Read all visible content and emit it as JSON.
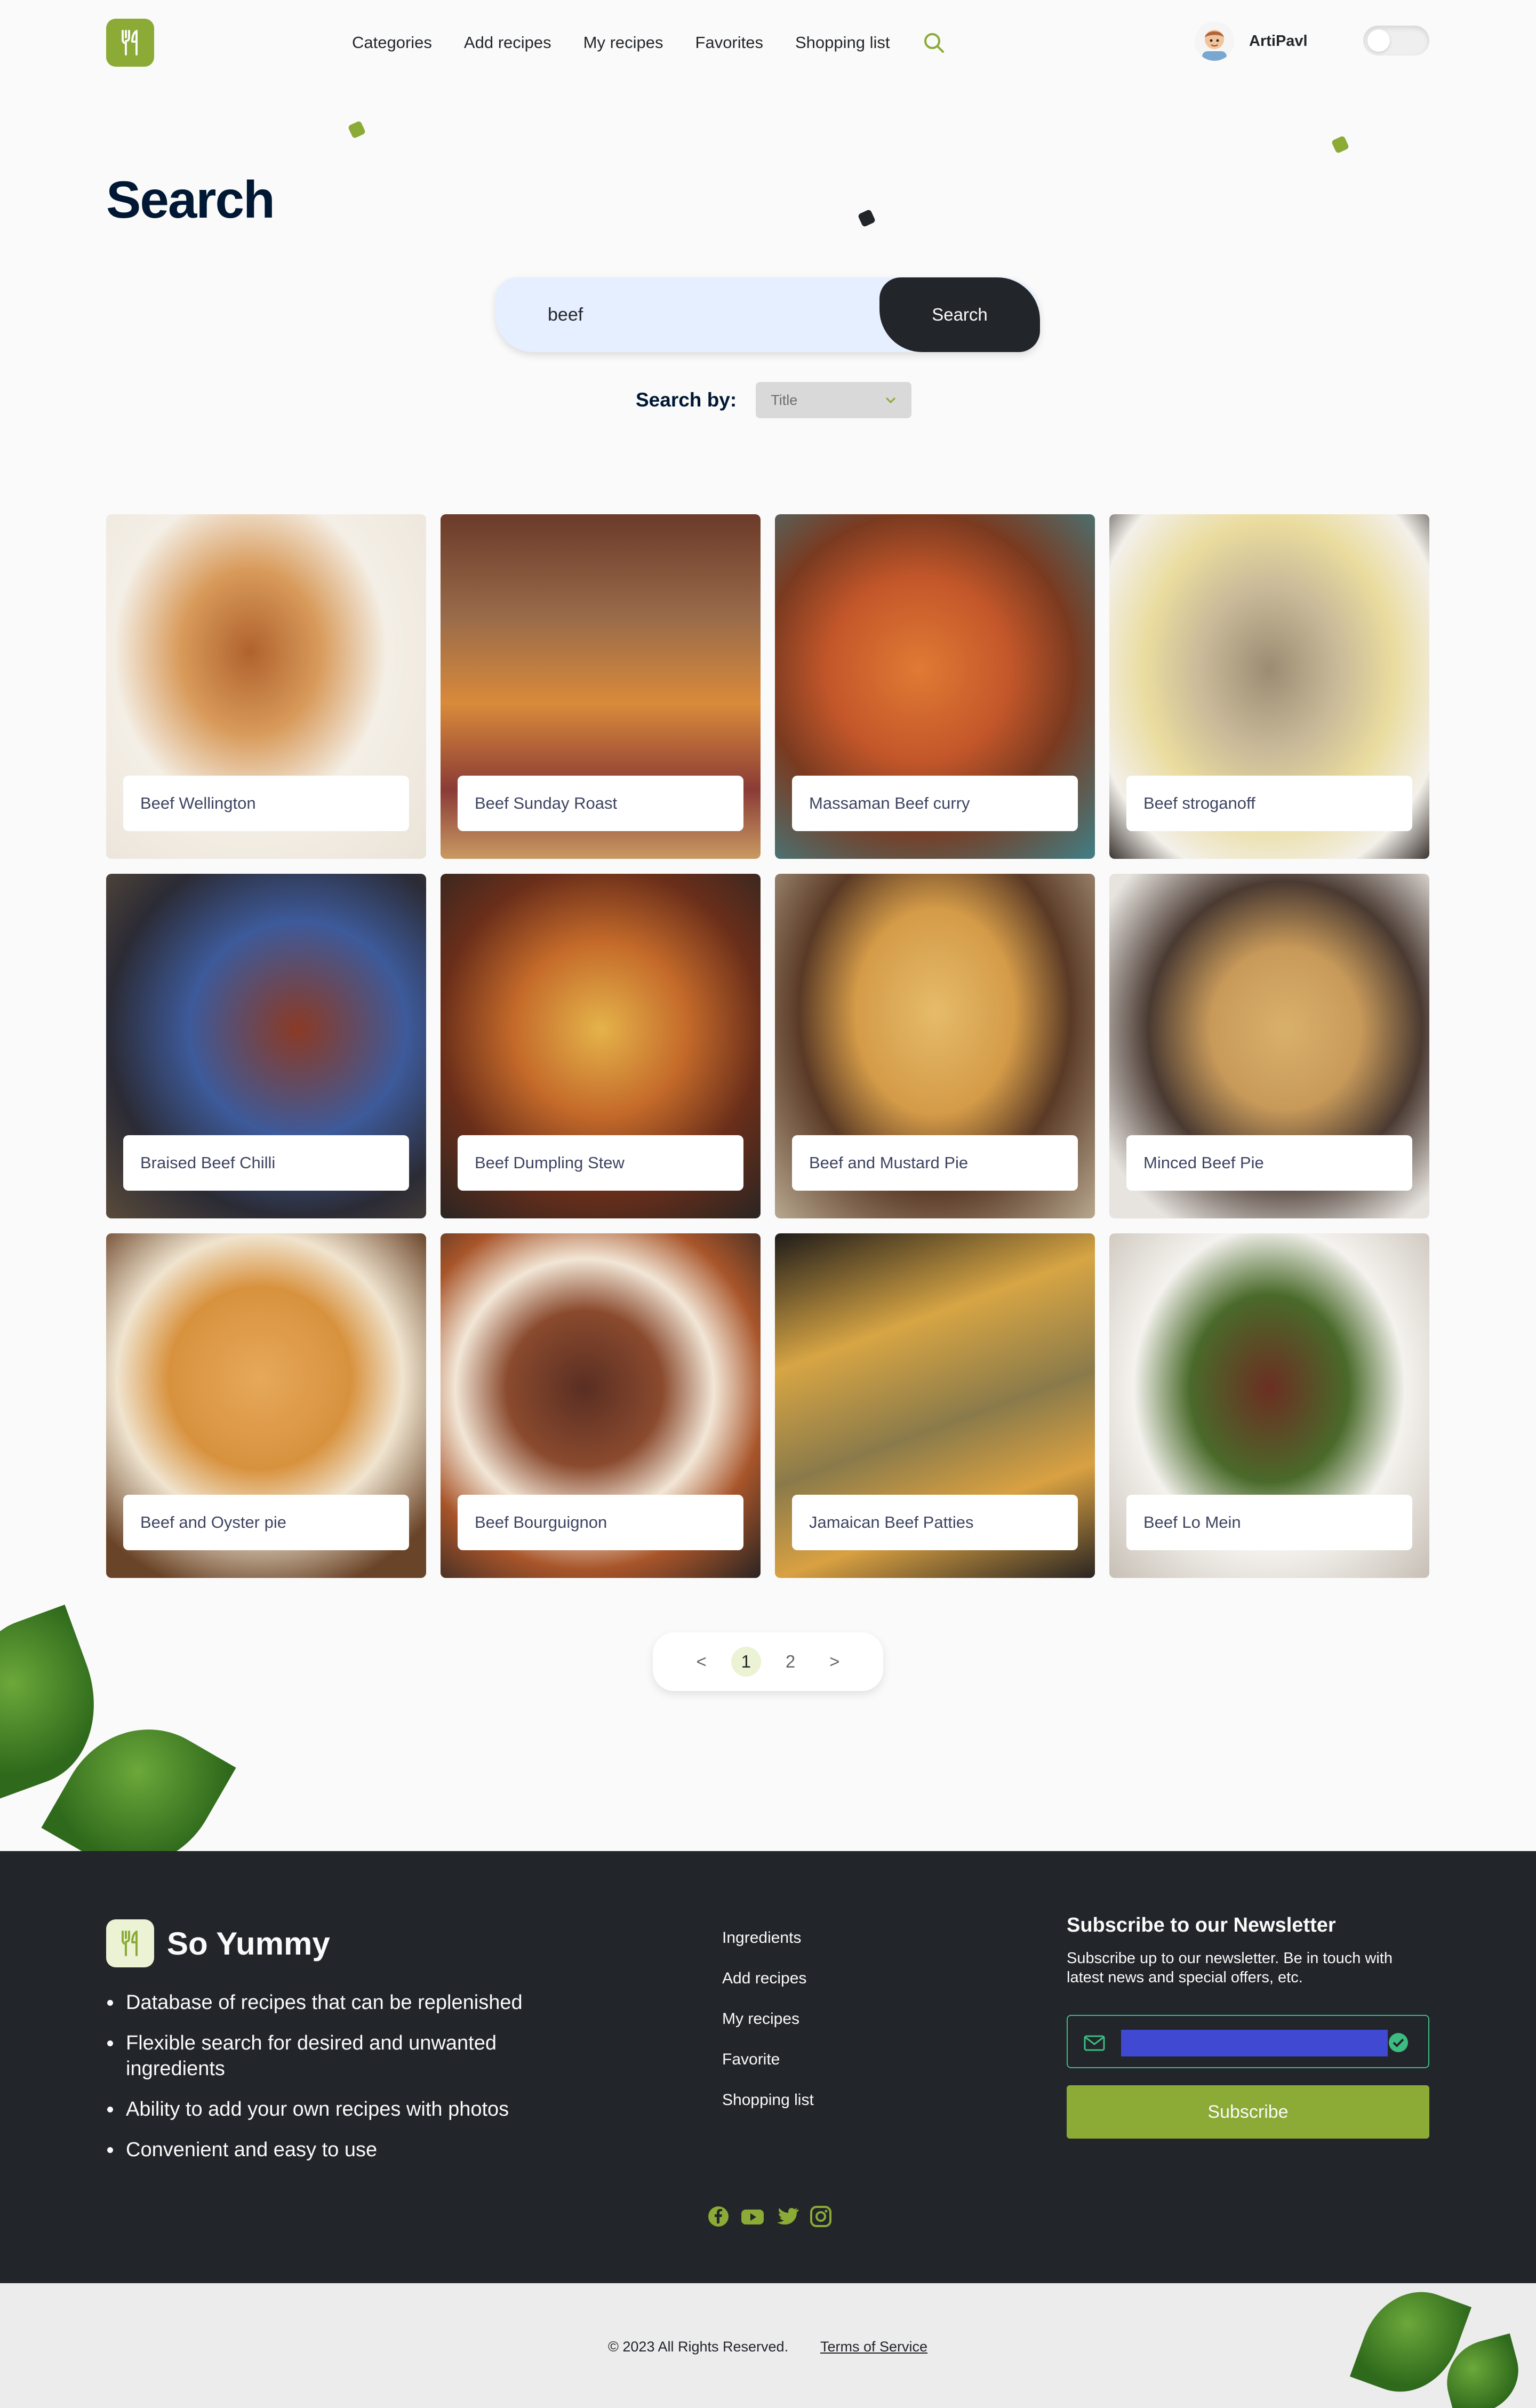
{
  "header": {
    "nav": [
      "Categories",
      "Add recipes",
      "My recipes",
      "Favorites",
      "Shopping list"
    ],
    "search_icon": "search-icon",
    "username": "ArtiPavl"
  },
  "page": {
    "title": "Search",
    "search_value": "beef",
    "search_button": "Search",
    "search_by_label": "Search by:",
    "search_by_value": "Title"
  },
  "recipes": [
    {
      "title": "Beef Wellington"
    },
    {
      "title": "Beef Sunday Roast"
    },
    {
      "title": "Massaman Beef curry"
    },
    {
      "title": "Beef stroganoff"
    },
    {
      "title": "Braised Beef Chilli"
    },
    {
      "title": "Beef Dumpling Stew"
    },
    {
      "title": "Beef and Mustard Pie"
    },
    {
      "title": "Minced Beef Pie"
    },
    {
      "title": "Beef and Oyster pie"
    },
    {
      "title": "Beef Bourguignon"
    },
    {
      "title": "Jamaican Beef Patties"
    },
    {
      "title": "Beef Lo Mein"
    }
  ],
  "pagination": {
    "prev": "<",
    "pages": [
      "1",
      "2"
    ],
    "next": ">",
    "current": "1"
  },
  "footer": {
    "brand": "So Yummy",
    "features": [
      "Database of recipes that can be replenished",
      "Flexible search for desired and unwanted ingredients",
      "Ability to add your own recipes with photos",
      "Convenient and easy to use"
    ],
    "nav": [
      "Ingredients",
      "Add recipes",
      "My recipes",
      "Favorite",
      "Shopping list"
    ],
    "newsletter": {
      "title": "Subscribe to our Newsletter",
      "text": "Subscribe up to our newsletter. Be in touch with latest news and special offers, etc.",
      "button": "Subscribe"
    },
    "socials": [
      "facebook-icon",
      "youtube-icon",
      "twitter-icon",
      "instagram-icon"
    ]
  },
  "bottom": {
    "copyright": "© 2023 All Rights Reserved.",
    "terms": "Terms of Service"
  },
  "colors": {
    "accent": "#8baa36",
    "dark": "#22252a",
    "title": "#001833",
    "search_bg": "#e6efff"
  }
}
